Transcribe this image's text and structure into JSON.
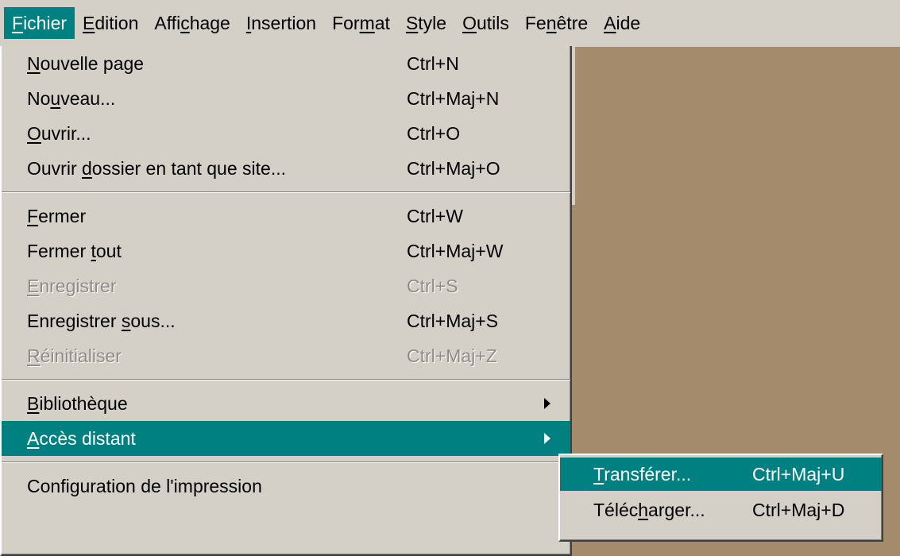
{
  "menubar": {
    "items": [
      {
        "label": "Fichier",
        "mnemonic_index": 0,
        "active": true
      },
      {
        "label": "Edition",
        "mnemonic_index": 0
      },
      {
        "label": "Affichage",
        "mnemonic_index": 4
      },
      {
        "label": "Insertion",
        "mnemonic_index": 0
      },
      {
        "label": "Format",
        "mnemonic_index": 3
      },
      {
        "label": "Style",
        "mnemonic_index": 0
      },
      {
        "label": "Outils",
        "mnemonic_index": 0
      },
      {
        "label": "Fenêtre",
        "mnemonic_index": 2
      },
      {
        "label": "Aide",
        "mnemonic_index": 0
      }
    ]
  },
  "file_menu": {
    "groups": [
      [
        {
          "label": "Nouvelle page",
          "mnemonic_index": 0,
          "shortcut": "Ctrl+N"
        },
        {
          "label": "Nouveau...",
          "mnemonic_index": 2,
          "shortcut": "Ctrl+Maj+N"
        },
        {
          "label": "Ouvrir...",
          "mnemonic_index": 0,
          "shortcut": "Ctrl+O"
        },
        {
          "label": "Ouvrir dossier en tant que site...",
          "mnemonic_index": 7,
          "shortcut": "Ctrl+Maj+O"
        }
      ],
      [
        {
          "label": "Fermer",
          "mnemonic_index": 0,
          "shortcut": "Ctrl+W"
        },
        {
          "label": "Fermer tout",
          "mnemonic_index": 7,
          "shortcut": "Ctrl+Maj+W"
        },
        {
          "label": "Enregistrer",
          "mnemonic_index": 0,
          "shortcut": "Ctrl+S",
          "disabled": true
        },
        {
          "label": "Enregistrer sous...",
          "mnemonic_index": 12,
          "shortcut": "Ctrl+Maj+S"
        },
        {
          "label": "Réinitialiser",
          "mnemonic_index": 0,
          "shortcut": "Ctrl+Maj+Z",
          "disabled": true
        }
      ],
      [
        {
          "label": "Bibliothèque",
          "mnemonic_index": 0,
          "submenu": true
        },
        {
          "label": "Accès distant",
          "mnemonic_index": 0,
          "submenu": true,
          "highlighted": true
        }
      ],
      [
        {
          "label": "Configuration de l'impression",
          "mnemonic_index": -1
        }
      ]
    ]
  },
  "remote_submenu": {
    "items": [
      {
        "label": "Transférer...",
        "mnemonic_index": 0,
        "shortcut": "Ctrl+Maj+U",
        "highlighted": true
      },
      {
        "label": "Télécharger...",
        "mnemonic_index": 5,
        "shortcut": "Ctrl+Maj+D"
      }
    ]
  },
  "colors": {
    "menu_face": "#d4d0c8",
    "highlight": "#008080",
    "desktop": "#a38b6b",
    "disabled_text": "#8f8b85"
  }
}
